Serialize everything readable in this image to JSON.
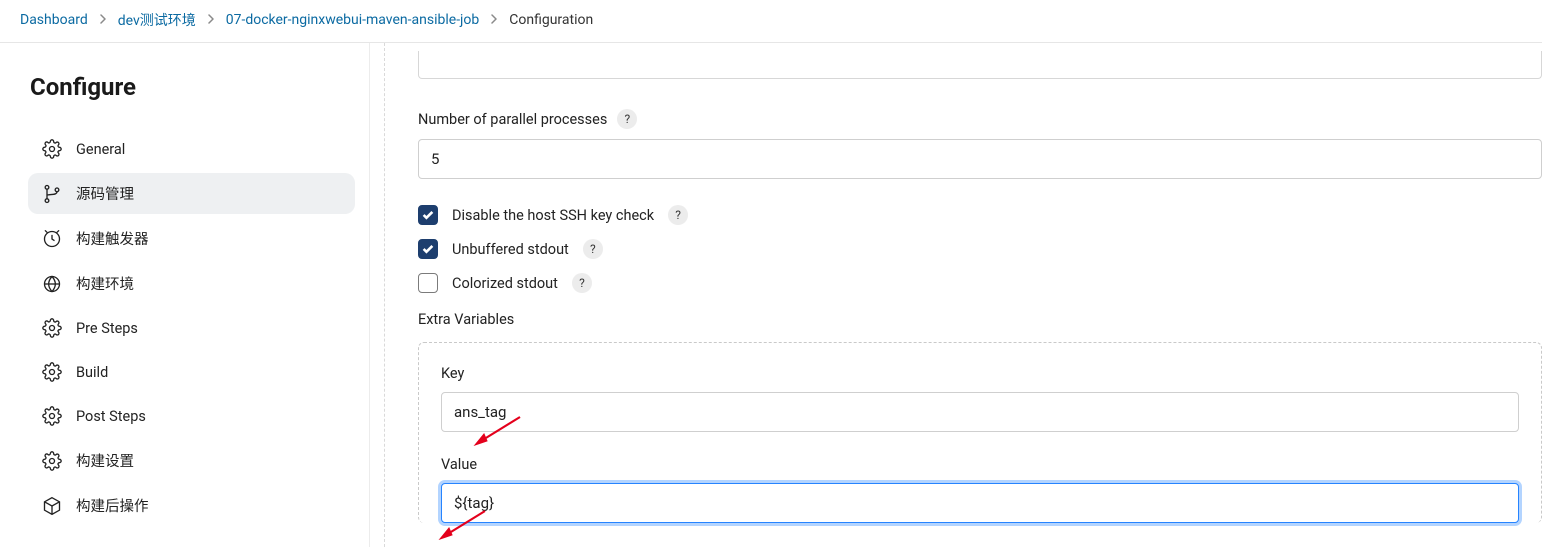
{
  "breadcrumbs": {
    "items": [
      "Dashboard",
      "dev测试环境",
      "07-docker-nginxwebui-maven-ansible-job",
      "Configuration"
    ]
  },
  "page_title": "Configure",
  "sidebar": {
    "items": [
      {
        "label": "General",
        "icon": "gear-icon",
        "active": false
      },
      {
        "label": "源码管理",
        "icon": "branch-icon",
        "active": true
      },
      {
        "label": "构建触发器",
        "icon": "clock-icon",
        "active": false
      },
      {
        "label": "构建环境",
        "icon": "globe-icon",
        "active": false
      },
      {
        "label": "Pre Steps",
        "icon": "gear-icon",
        "active": false
      },
      {
        "label": "Build",
        "icon": "gear-icon",
        "active": false
      },
      {
        "label": "Post Steps",
        "icon": "gear-icon",
        "active": false
      },
      {
        "label": "构建设置",
        "icon": "gear-icon",
        "active": false
      },
      {
        "label": "构建后操作",
        "icon": "box-icon",
        "active": false
      }
    ]
  },
  "form": {
    "parallel": {
      "label": "Number of parallel processes",
      "value": "5"
    },
    "checkboxes": [
      {
        "label": "Disable the host SSH key check",
        "checked": true
      },
      {
        "label": "Unbuffered stdout",
        "checked": true
      },
      {
        "label": "Colorized stdout",
        "checked": false
      }
    ],
    "extra_vars": {
      "section_label": "Extra Variables",
      "key_label": "Key",
      "key_value": "ans_tag",
      "value_label": "Value",
      "value_value": "${tag}"
    }
  },
  "help_glyph": "?"
}
